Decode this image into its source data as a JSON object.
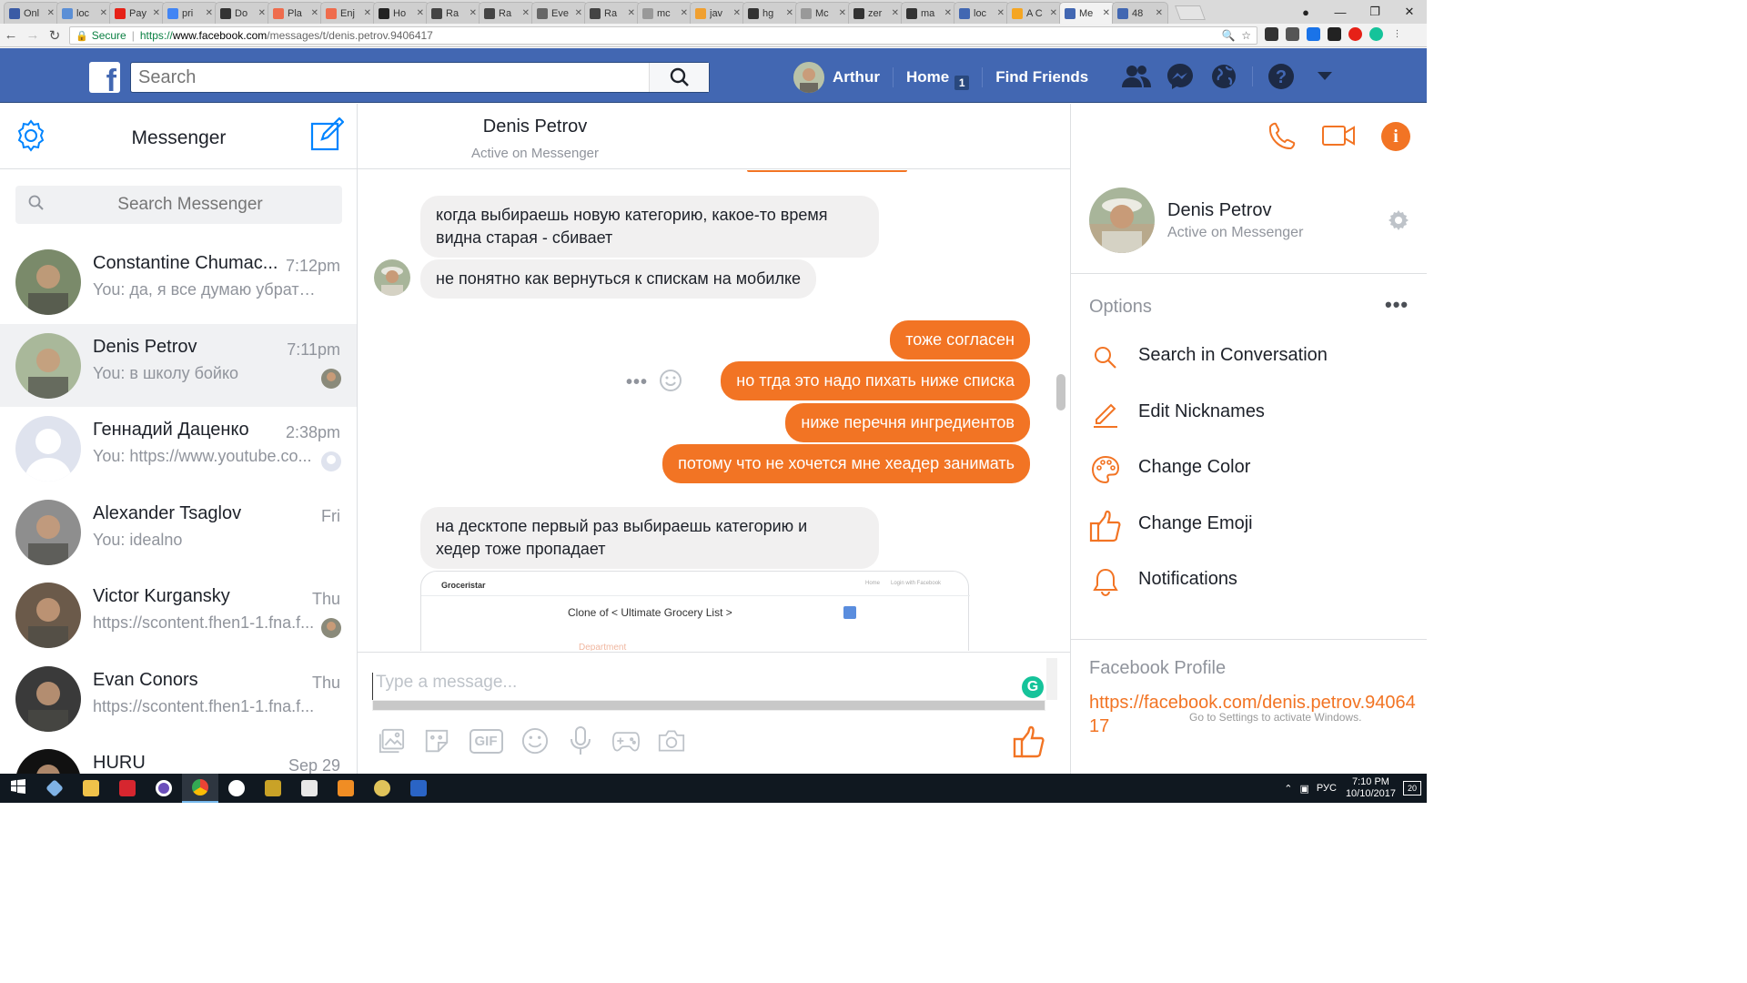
{
  "browser": {
    "tabs": [
      {
        "label": "Onl",
        "color": "#3b5ba5"
      },
      {
        "label": "loc",
        "color": "#5b8fd6"
      },
      {
        "label": "Pay",
        "color": "#e62117"
      },
      {
        "label": "pri",
        "color": "#4285f4"
      },
      {
        "label": "Do",
        "color": "#333333"
      },
      {
        "label": "Pla",
        "color": "#ef6c4d"
      },
      {
        "label": "Enj",
        "color": "#ef6c4d"
      },
      {
        "label": "Ho",
        "color": "#222222"
      },
      {
        "label": "Ra",
        "color": "#444444"
      },
      {
        "label": "Ra",
        "color": "#444444"
      },
      {
        "label": "Eve",
        "color": "#666666"
      },
      {
        "label": "Ra",
        "color": "#444444"
      },
      {
        "label": "mc",
        "color": "#999999"
      },
      {
        "label": "jav",
        "color": "#f0a030"
      },
      {
        "label": "hg",
        "color": "#333333"
      },
      {
        "label": "Mc",
        "color": "#999999"
      },
      {
        "label": "zer",
        "color": "#333333"
      },
      {
        "label": "ma",
        "color": "#333333"
      },
      {
        "label": "loc",
        "color": "#4267b2"
      },
      {
        "label": "A C",
        "color": "#f5a623"
      },
      {
        "label": "Me",
        "color": "#4267b2",
        "active": true
      },
      {
        "label": "48",
        "color": "#4267b2"
      }
    ],
    "url_secure_label": "Secure",
    "url_scheme": "https://",
    "url_host": "www.facebook.com",
    "url_path": "/messages/t/denis.petrov.9406417"
  },
  "fb": {
    "search_placeholder": "Search",
    "user_name": "Arthur",
    "home_label": "Home",
    "home_badge": "1",
    "find_friends": "Find Friends"
  },
  "messenger": {
    "title": "Messenger",
    "search_placeholder": "Search Messenger",
    "threads": [
      {
        "name": "Constantine Chumac...",
        "time": "7:12pm",
        "snippet": "You: да, я все думаю убрать ...",
        "avatar": "#7a8a6a"
      },
      {
        "name": "Denis Petrov",
        "time": "7:11pm",
        "snippet": "You: в школу бойко",
        "avatar": "#a9b89a",
        "active": true
      },
      {
        "name": "Геннадий Даценко",
        "time": "2:38pm",
        "snippet": "You: https://www.youtube.co...",
        "avatar": "#dfe3ee"
      },
      {
        "name": "Alexander Tsaglov",
        "time": "Fri",
        "snippet": "You: idealno",
        "avatar": "#8e8e8e"
      },
      {
        "name": "Victor Kurgansky",
        "time": "Thu",
        "snippet": "https://scontent.fhen1-1.fna.f...",
        "avatar": "#6b5a4a"
      },
      {
        "name": "Evan Conors",
        "time": "Thu",
        "snippet": "https://scontent.fhen1-1.fna.f...",
        "avatar": "#3a3a3a"
      },
      {
        "name": "HURU",
        "time": "Sep 29",
        "snippet": "",
        "avatar": "#111111"
      }
    ]
  },
  "conversation": {
    "name": "Denis Petrov",
    "status": "Active on Messenger",
    "messages": [
      {
        "dir": "in",
        "text": "когда выбираешь новую категорию, какое-то время\nвидна старая - сбивает"
      },
      {
        "dir": "in",
        "text": "не понятно как вернуться к спискам на мобилке"
      },
      {
        "dir": "out",
        "text": "тоже согласен"
      },
      {
        "dir": "out",
        "text": "но тгда это надо пихать ниже списка"
      },
      {
        "dir": "out",
        "text": "ниже перечня ингредиентов"
      },
      {
        "dir": "out",
        "text": "потому что не хочется мне хеадер занимать"
      },
      {
        "dir": "in",
        "text": "на десктопе первый раз выбираешь категорию и\nхедер тоже пропадает"
      }
    ],
    "attachment": {
      "brand": "Groceristar",
      "nav_home": "Home",
      "nav_login": "Login with Facebook",
      "heading": "Clone of < Ultimate Grocery List >",
      "partial_label": "Department"
    },
    "composer_placeholder": "Type a message...",
    "gif_label": "GIF"
  },
  "details": {
    "name": "Denis Petrov",
    "status": "Active on Messenger",
    "options_label": "Options",
    "options": [
      {
        "label": "Search in Conversation",
        "icon": "search-icon"
      },
      {
        "label": "Edit Nicknames",
        "icon": "pencil-icon"
      },
      {
        "label": "Change Color",
        "icon": "palette-icon"
      },
      {
        "label": "Change Emoji",
        "icon": "thumbs-up-icon"
      },
      {
        "label": "Notifications",
        "icon": "bell-icon"
      }
    ],
    "profile_heading": "Facebook Profile",
    "profile_link": "https://facebook.com/denis.petrov.9406417",
    "watermark": "Go to Settings to activate Windows."
  },
  "taskbar": {
    "lang": "РУС",
    "time": "7:10 PM",
    "date": "10/10/2017",
    "notif_count": "20"
  },
  "colors": {
    "accent": "#f27424",
    "fb_blue": "#4267b2"
  }
}
